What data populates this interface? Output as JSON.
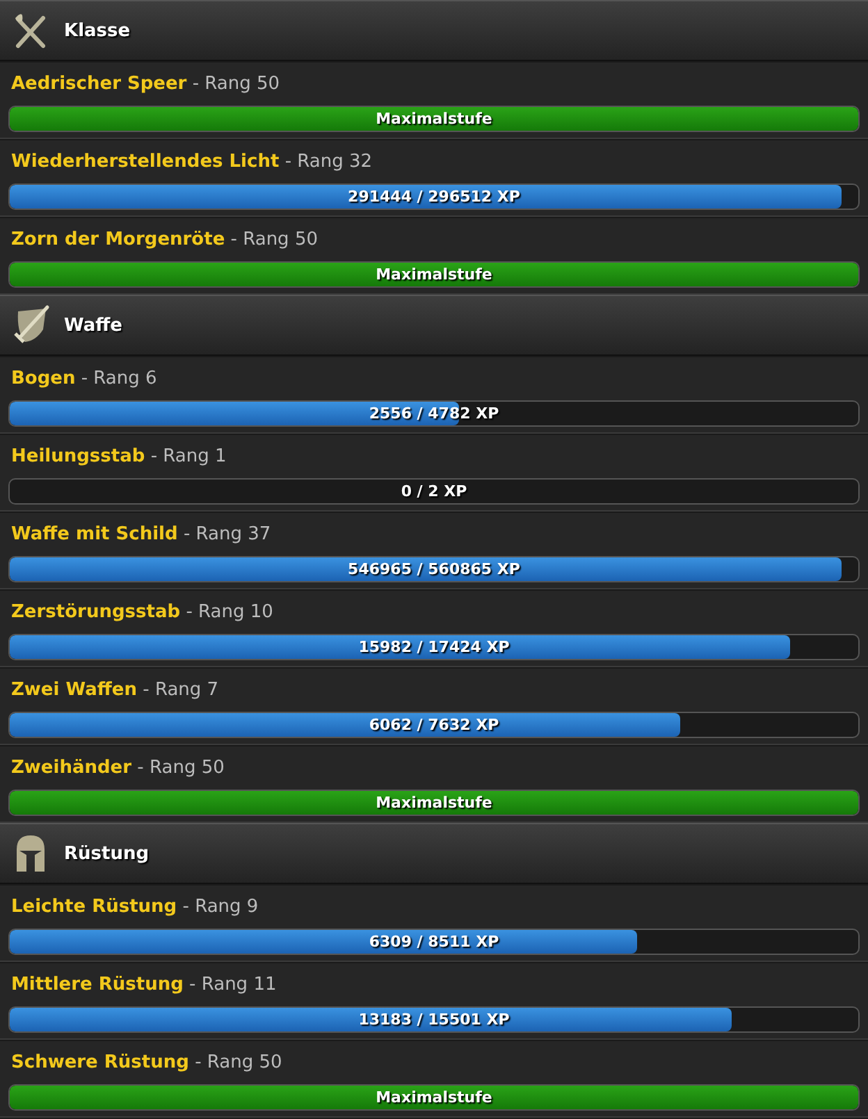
{
  "sections": [
    {
      "title": "Klasse",
      "kind": "class",
      "skills": [
        {
          "name": "Aedrischer Speer",
          "rank": "- Rang 50",
          "kind": "max",
          "level": 1,
          "bar_text": "Maximalstufe"
        },
        {
          "name": "Wiederherstellendes Licht",
          "rank": "- Rang 32",
          "kind": "xp",
          "level": 0.98,
          "bar_text": "291444 / 296512 XP"
        },
        {
          "name": "Zorn der Morgenröte",
          "rank": "- Rang 50",
          "kind": "max",
          "level": 1,
          "bar_text": "Maximalstufe"
        }
      ]
    },
    {
      "title": "Waffe",
      "kind": "weapon",
      "skills": [
        {
          "name": "Bogen",
          "rank": "- Rang 6",
          "kind": "xp",
          "level": 0.53,
          "bar_text": "2556 / 4782 XP"
        },
        {
          "name": "Heilungsstab",
          "rank": "- Rang 1",
          "kind": "xp",
          "bar_text": "0 / 2 XP"
        },
        {
          "name": "Waffe mit Schild",
          "rank": "- Rang 37",
          "kind": "xp",
          "level": 0.98,
          "bar_text": "546965 / 560865 XP"
        },
        {
          "name": "Zerstörungsstab",
          "rank": "- Rang 10",
          "kind": "xp",
          "level": 0.92,
          "bar_text": "15982 / 17424 XP"
        },
        {
          "name": "Zwei Waffen",
          "rank": "- Rang 7",
          "kind": "xp",
          "level": 0.79,
          "bar_text": "6062 / 7632 XP"
        },
        {
          "name": "Zweihänder",
          "rank": "- Rang 50",
          "kind": "max",
          "level": 1,
          "bar_text": "Maximalstufe"
        }
      ]
    },
    {
      "title": "Rüstung",
      "kind": "armor",
      "skills": [
        {
          "name": "Leichte Rüstung",
          "rank": "- Rang 9",
          "kind": "xp",
          "level": 0.74,
          "bar_text": "6309 / 8511 XP"
        },
        {
          "name": "Mittlere Rüstung",
          "rank": "- Rang 11",
          "kind": "xp",
          "level": 0.85,
          "bar_text": "13183 / 15501 XP"
        },
        {
          "name": "Schwere Rüstung",
          "rank": "- Rang 50",
          "kind": "max",
          "level": 1,
          "bar_text": "Maximalstufe"
        }
      ]
    }
  ]
}
